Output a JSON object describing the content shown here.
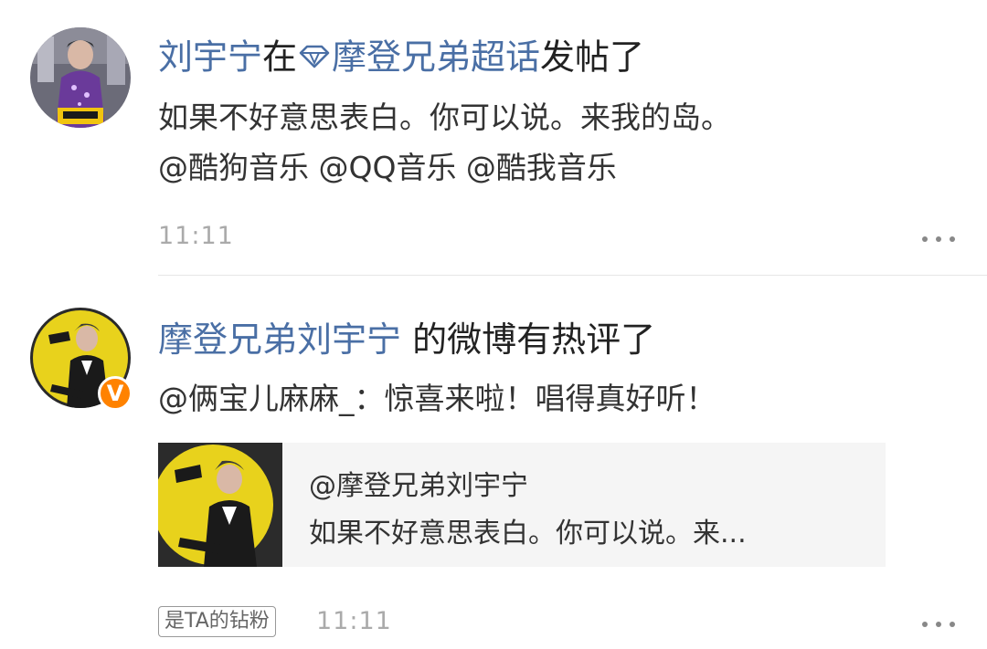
{
  "feed": [
    {
      "user": "刘宇宁",
      "connector": "在",
      "topic": "摩登兄弟超话",
      "action": "发帖了",
      "topic_icon": "diamond-icon",
      "text_line1": "如果不好意思表白。你可以说。来我的岛。",
      "text_line2": "@酷狗音乐 @QQ音乐 @酷我音乐",
      "time": "11:11"
    },
    {
      "user": "摩登兄弟刘宇宁",
      "action": " 的微博有热评了",
      "verified_badge": "V",
      "comment": "@俩宝儿麻麻_：惊喜来啦！唱得真好听！",
      "quote": {
        "author": "@摩登兄弟刘宇宁",
        "snippet": "如果不好意思表白。你可以说。来..."
      },
      "fan_badge": "是TA的钻粉",
      "time": "11:11"
    }
  ],
  "colors": {
    "link": "#4a6fa5",
    "verified": "#ff8200",
    "time": "#aaaaaa",
    "quote_bg": "#f5f5f5"
  }
}
